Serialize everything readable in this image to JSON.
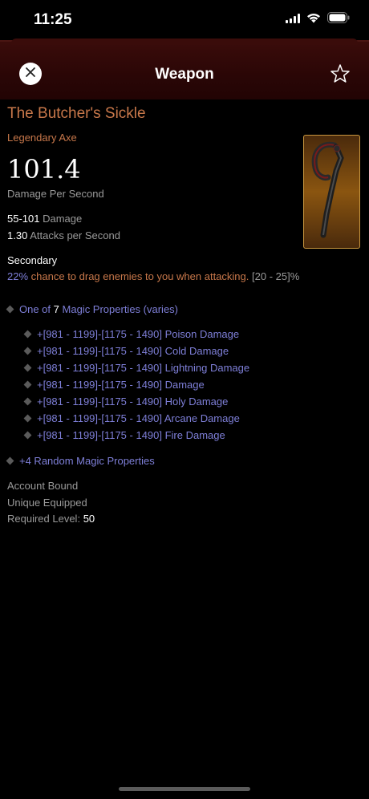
{
  "status_bar": {
    "time": "11:25"
  },
  "header": {
    "title": "Weapon"
  },
  "item": {
    "name": "The Butcher's Sickle",
    "type": "Legendary Axe",
    "dps_value": "101.4",
    "dps_label": "Damage Per Second",
    "damage_value": "55-101",
    "damage_label": "Damage",
    "aps_value": "1.30",
    "aps_label": "Attacks per Second",
    "secondary_label": "Secondary",
    "secondary_pct": "22%",
    "secondary_text": "chance to drag enemies to you when attacking.",
    "secondary_range": "[20 - 25]%",
    "magic_prefix": "One of",
    "magic_count": "7",
    "magic_label": "Magic Properties (varies)",
    "magic_options": [
      "+[981 - 1199]-[1175 - 1490] Poison Damage",
      "+[981 - 1199]-[1175 - 1490] Cold Damage",
      "+[981 - 1199]-[1175 - 1490] Lightning Damage",
      "+[981 - 1199]-[1175 - 1490] Damage",
      "+[981 - 1199]-[1175 - 1490] Holy Damage",
      "+[981 - 1199]-[1175 - 1490] Arcane Damage",
      "+[981 - 1199]-[1175 - 1490] Fire Damage"
    ],
    "random_props": "+4 Random Magic Properties",
    "account_bound": "Account Bound",
    "unique_equipped": "Unique Equipped",
    "required_level_label": "Required Level:",
    "required_level_value": "50"
  },
  "colors": {
    "legendary": "#c7774a",
    "magic": "#7e7fd8",
    "header_bg": "#2a0606"
  },
  "icons": {
    "close": "close-icon",
    "favorite": "star-icon",
    "wifi": "wifi-icon",
    "battery": "battery-icon"
  }
}
